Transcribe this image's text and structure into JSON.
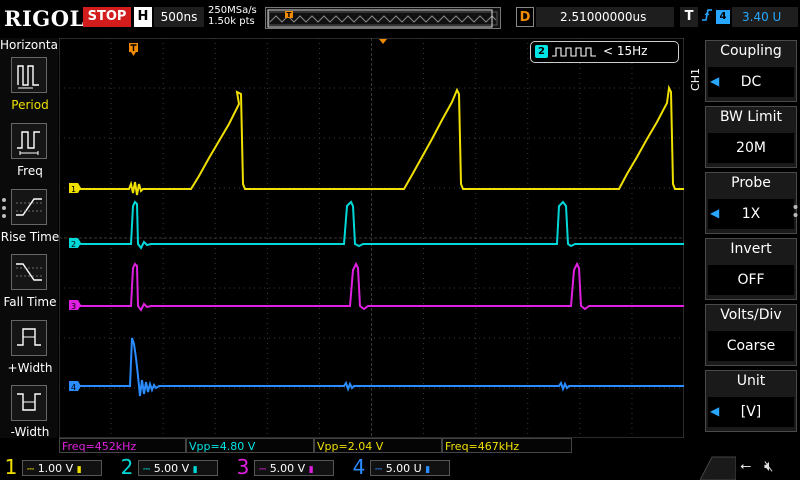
{
  "header": {
    "brand": "RIGOL",
    "run_state": "STOP",
    "timebase_label": "H",
    "timebase_value": "500ns",
    "sample_rate": "250MSa/s",
    "memory_depth": "1.50k pts",
    "delay_label": "D",
    "delay_value": "2.51000000us",
    "trigger_label": "T",
    "trigger_source": "4",
    "trigger_level": "3.40 U"
  },
  "left_menu": {
    "title": "Horizontal",
    "items": [
      {
        "label": "Period",
        "icon": "period-icon"
      },
      {
        "label": "Freq",
        "icon": "freq-icon"
      },
      {
        "label": "Rise Time",
        "icon": "rise-time-icon"
      },
      {
        "label": "Fall Time",
        "icon": "fall-time-icon"
      },
      {
        "label": "+Width",
        "icon": "positive-width-icon"
      },
      {
        "label": "-Width",
        "icon": "negative-width-icon"
      }
    ]
  },
  "right_menu": {
    "channel": "CH1",
    "items": [
      {
        "title": "Coupling",
        "value": "DC"
      },
      {
        "title": "BW Limit",
        "value": "20M"
      },
      {
        "title": "Probe",
        "value": "1X"
      },
      {
        "title": "Invert",
        "value": "OFF"
      },
      {
        "title": "Volts/Div",
        "value": "Coarse"
      },
      {
        "title": "Unit",
        "value": "[V]"
      }
    ]
  },
  "freq_counter": {
    "channel": "2",
    "text": "< 15Hz"
  },
  "measurements": [
    {
      "text": "Freq=452kHz",
      "color": "#e020e0"
    },
    {
      "text": "Vpp=4.80 V",
      "color": "#00e5e5"
    },
    {
      "text": "Vpp=2.04 V",
      "color": "#f0e000"
    },
    {
      "text": "Freq=467kHz",
      "color": "#f0e000"
    }
  ],
  "channels": [
    {
      "number": "1",
      "scale": "1.00 V",
      "color": "#f0e000"
    },
    {
      "number": "2",
      "scale": "5.00 V",
      "color": "#00d8d8"
    },
    {
      "number": "3",
      "scale": "5.00 V",
      "color": "#e020e0"
    },
    {
      "number": "4",
      "scale": "5.00 U",
      "color": "#2a8cff"
    }
  ],
  "trace_markers": [
    "1",
    "2",
    "3",
    "4"
  ],
  "colors": {
    "ch1": "#f0e000",
    "ch2": "#00d8d8",
    "ch3": "#e020e0",
    "ch4": "#2a8cff",
    "trigger": "#f08a00",
    "accent": "#27a7ff",
    "stop": "#d31d1d"
  }
}
